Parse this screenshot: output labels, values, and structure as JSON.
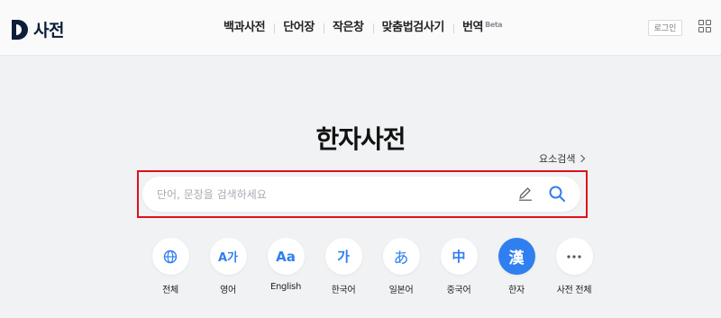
{
  "header": {
    "logo_text": "사전",
    "nav": [
      {
        "label": "백과사전"
      },
      {
        "label": "단어장"
      },
      {
        "label": "작은창"
      },
      {
        "label": "맞춤법검사기"
      },
      {
        "label": "번역",
        "badge": "Beta"
      }
    ],
    "login_label": "로그인"
  },
  "main": {
    "title": "한자사전",
    "advanced_search_label": "요소검색",
    "search": {
      "placeholder": "단어, 문장을 검색하세요",
      "value": ""
    },
    "categories": [
      {
        "label": "전체",
        "icon": "globe-icon"
      },
      {
        "label": "영어",
        "glyph": "A가"
      },
      {
        "label": "English",
        "glyph": "Aa"
      },
      {
        "label": "한국어",
        "glyph": "가"
      },
      {
        "label": "일본어",
        "glyph": "あ"
      },
      {
        "label": "중국어",
        "glyph": "中"
      },
      {
        "label": "한자",
        "glyph": "漢",
        "active": true
      },
      {
        "label": "사전 전체",
        "icon": "more-icon"
      }
    ]
  },
  "colors": {
    "accent": "#2f7ff0",
    "highlight_frame": "#e0101a",
    "logo": "#0b1e3a"
  }
}
